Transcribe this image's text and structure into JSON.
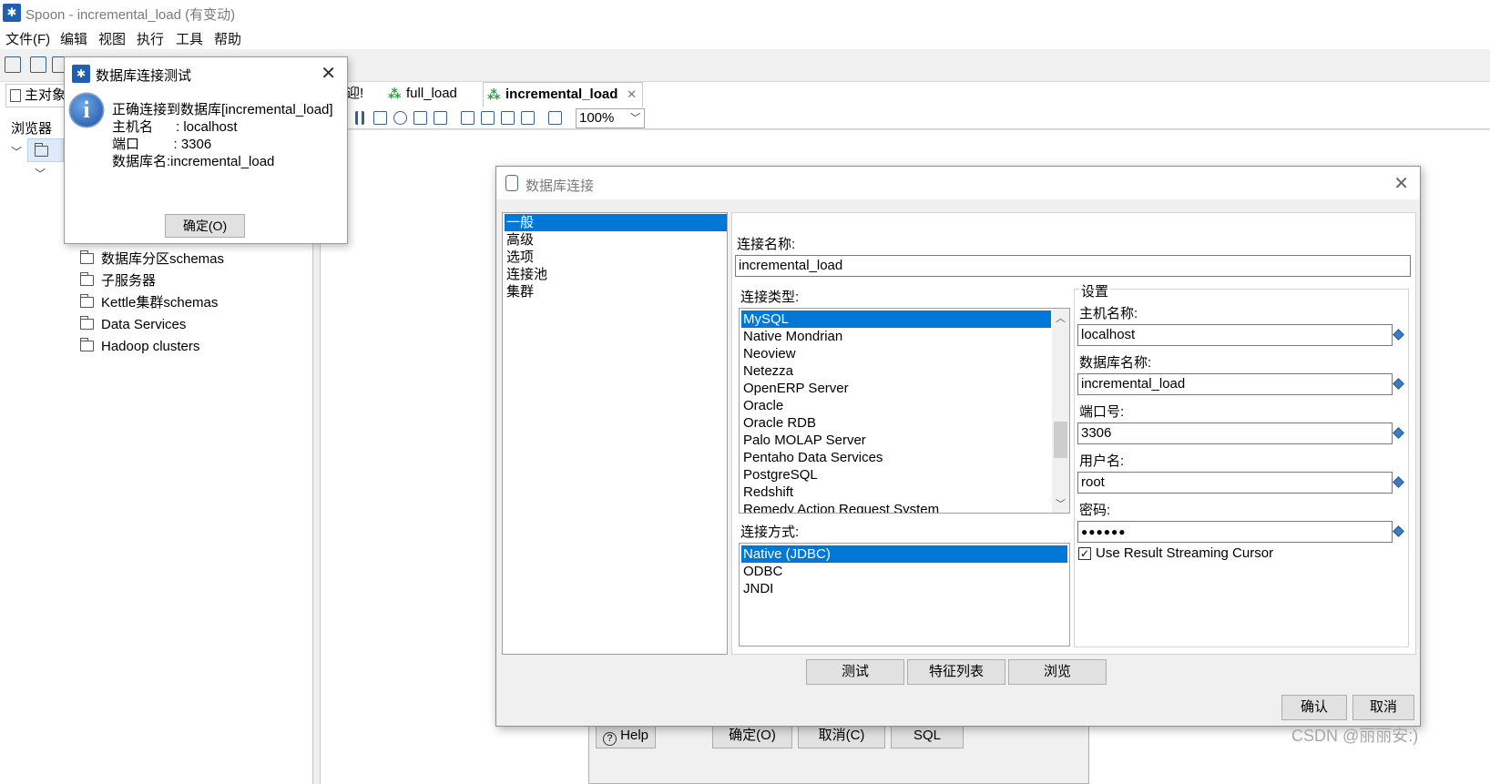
{
  "window": {
    "title": "Spoon - incremental_load (有变动)"
  },
  "menu": [
    "文件(F)",
    "编辑",
    "视图",
    "执行",
    "工具",
    "帮助"
  ],
  "left_panel": {
    "tab_main": "主对象",
    "tab_browser": "浏览器",
    "tree_items": [
      "数据库分区schemas",
      "子服务器",
      "Kettle集群schemas",
      "Data Services",
      "Hadoop clusters"
    ]
  },
  "editor_tabs": [
    "迎!",
    "full_load",
    "incremental_load"
  ],
  "zoom": "100%",
  "underlying_dialog": {
    "help": "Help",
    "ok": "确定(O)",
    "cancel": "取消(C)",
    "sql": "SQL"
  },
  "test_dialog": {
    "title": "数据库连接测试",
    "lines": [
      "正确连接到数据库[incremental_load]",
      "主机名      : localhost",
      "端口         : 3306",
      "数据库名:incremental_load"
    ],
    "ok": "确定(O)"
  },
  "db_dialog": {
    "title": "数据库连接",
    "categories": [
      "一般",
      "高级",
      "选项",
      "连接池",
      "集群"
    ],
    "selected_category": "一般",
    "connection_name_label": "连接名称:",
    "connection_name": "incremental_load",
    "connection_type_label": "连接类型:",
    "connection_types": [
      "MySQL",
      "Native Mondrian",
      "Neoview",
      "Netezza",
      "OpenERP Server",
      "Oracle",
      "Oracle RDB",
      "Palo MOLAP Server",
      "Pentaho Data Services",
      "PostgreSQL",
      "Redshift",
      "Remedy Action Request System"
    ],
    "selected_type": "MySQL",
    "access_label": "连接方式:",
    "access_methods": [
      "Native (JDBC)",
      "ODBC",
      "JNDI"
    ],
    "selected_access": "Native (JDBC)",
    "settings": {
      "group_label": "设置",
      "host_label": "主机名称:",
      "host": "localhost",
      "db_label": "数据库名称:",
      "db": "incremental_load",
      "port_label": "端口号:",
      "port": "3306",
      "user_label": "用户名:",
      "user": "root",
      "password_label": "密码:",
      "password": "●●●●●●",
      "streaming_label": "Use Result Streaming Cursor",
      "streaming_checked": true
    },
    "buttons": {
      "test": "测试",
      "features": "特征列表",
      "explore": "浏览",
      "confirm": "确认",
      "cancel": "取消"
    }
  },
  "watermark": "CSDN @丽丽安:)"
}
